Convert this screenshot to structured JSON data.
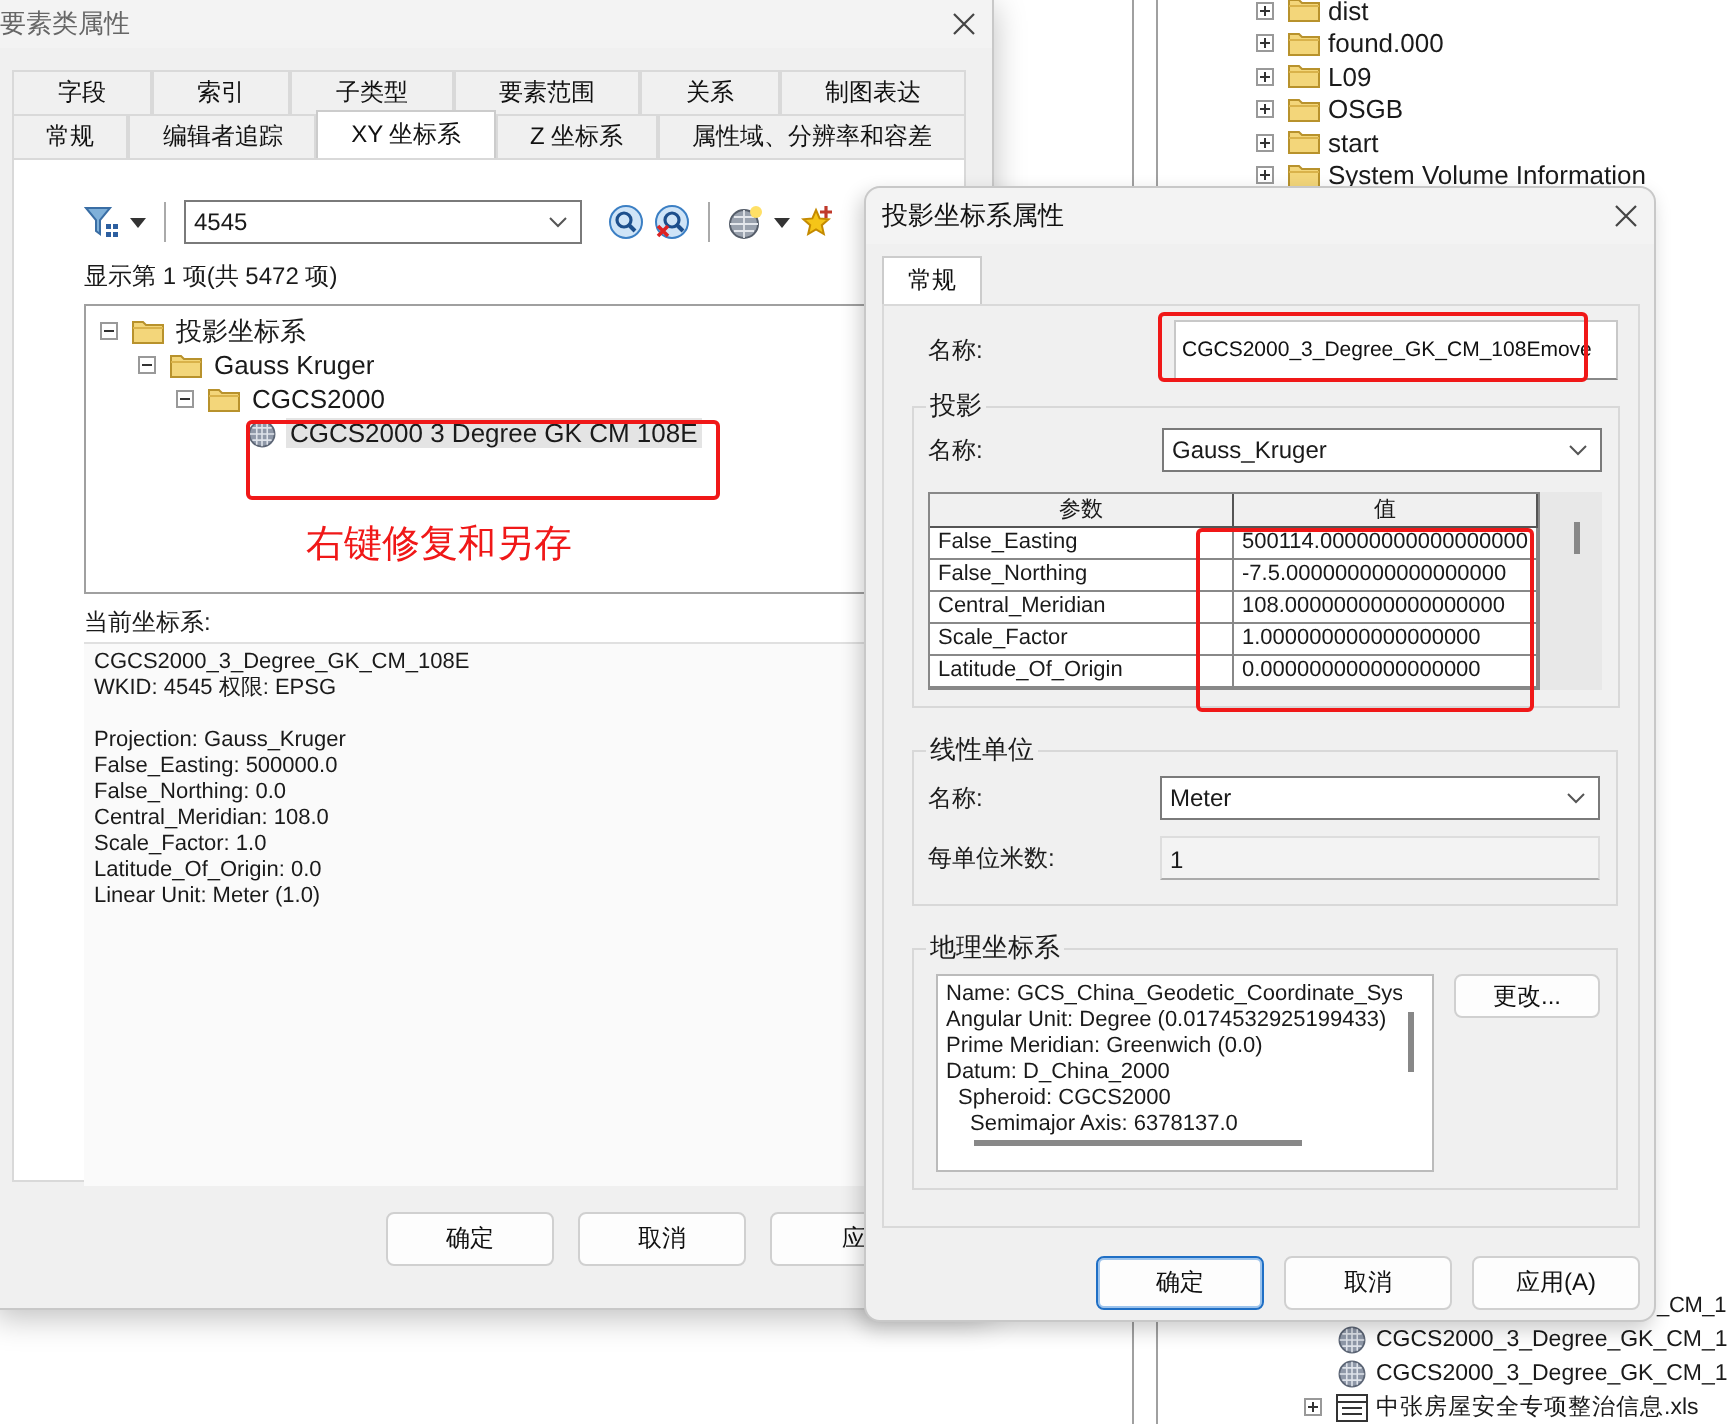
{
  "explorer": {
    "top_items": [
      {
        "label": "dist",
        "kind": "folder",
        "expandable": true
      },
      {
        "label": "found.000",
        "kind": "folder",
        "expandable": true
      },
      {
        "label": "L09",
        "kind": "folder",
        "expandable": true
      },
      {
        "label": "OSGB",
        "kind": "folder",
        "expandable": true
      },
      {
        "label": "start",
        "kind": "folder",
        "expandable": true
      },
      {
        "label": "System Volume Information",
        "kind": "folder",
        "expandable": true
      }
    ],
    "bottom_items": [
      {
        "label": "_CM_1",
        "partial": true
      },
      {
        "label": "CGCS2000_3_Degree_GK_CM_1",
        "kind": "globe",
        "expandable": false,
        "partial": false
      },
      {
        "label": "CGCS2000_3_Degree_GK_CM_1",
        "kind": "globe",
        "expandable": false,
        "partial": false
      },
      {
        "label": "中张房屋安全专项整治信息.xls",
        "kind": "table",
        "expandable": true,
        "partial": false
      }
    ]
  },
  "feature_class_dialog": {
    "title": "要素类属性",
    "tab_rows": [
      [
        {
          "label": "字段",
          "selected": false
        },
        {
          "label": "索引",
          "selected": false
        },
        {
          "label": "子类型",
          "selected": false
        },
        {
          "label": "要素范围",
          "selected": false
        },
        {
          "label": "关系",
          "selected": false
        },
        {
          "label": "制图表达",
          "selected": false
        }
      ],
      [
        {
          "label": "常规",
          "selected": false
        },
        {
          "label": "编辑者追踪",
          "selected": false
        },
        {
          "label": "XY 坐标系",
          "selected": true
        },
        {
          "label": "Z 坐标系",
          "selected": false
        },
        {
          "label": "属性域、分辨率和容差",
          "selected": false
        }
      ]
    ],
    "search_value": "4545",
    "match_count": "显示第 1 项(共 5472 项)",
    "tree": [
      {
        "label": "投影坐标系",
        "kind": "folder",
        "selected": false,
        "children": [
          {
            "label": "Gauss Kruger",
            "kind": "folder",
            "selected": false,
            "children": [
              {
                "label": "CGCS2000",
                "kind": "folder",
                "selected": false,
                "children": [
                  {
                    "label": "CGCS2000 3 Degree GK CM 108E",
                    "kind": "globe",
                    "selected": true
                  }
                ]
              }
            ]
          }
        ]
      }
    ],
    "annotation": "右键修复和另存",
    "current_label": "当前坐标系:",
    "current_blocks": [
      [
        "CGCS2000_3_Degree_GK_CM_108E",
        "WKID: 4545 权限: EPSG"
      ],
      [
        "Projection: Gauss_Kruger",
        "False_Easting: 500000.0",
        "False_Northing: 0.0",
        "Central_Meridian: 108.0",
        "Scale_Factor: 1.0",
        "Latitude_Of_Origin: 0.0",
        "Linear Unit: Meter (1.0)"
      ]
    ],
    "buttons": [
      "确定",
      "取消",
      "应"
    ]
  },
  "projection_dialog": {
    "title": "投影坐标系属性",
    "tabs": [
      {
        "label": "常规",
        "selected": true
      }
    ],
    "name_label": "名称:",
    "name_value": "CGCS2000_3_Degree_GK_CM_108Emove",
    "projection": {
      "legend": "投影",
      "name_label": "名称:",
      "name_value": "Gauss_Kruger",
      "columns": [
        "参数",
        "值"
      ],
      "rows": [
        [
          "False_Easting",
          "500114.00000000000000000"
        ],
        [
          "False_Northing",
          "-7.5.000000000000000000"
        ],
        [
          "Central_Meridian",
          "108.000000000000000000"
        ],
        [
          "Scale_Factor",
          "1.000000000000000000"
        ],
        [
          "Latitude_Of_Origin",
          "0.000000000000000000"
        ]
      ]
    },
    "linear_unit": {
      "legend": "线性单位",
      "name_label": "名称:",
      "name_value": "Meter",
      "meters_label": "每单位米数:",
      "meters_value": "1"
    },
    "geographic": {
      "legend": "地理坐标系",
      "change_button": "更改...",
      "lines": [
        {
          "text": "Name: GCS_China_Geodetic_Coordinate_Sys"
        },
        {
          "text": "Angular Unit: Degree (0.0174532925199433)"
        },
        {
          "text": "Prime Meridian: Greenwich (0.0)"
        },
        {
          "text": "Datum: D_China_2000",
          "children": [
            {
              "text": "Spheroid: CGCS2000",
              "children": [
                {
                  "text": "Semimajor Axis: 6378137.0"
                }
              ]
            }
          ]
        }
      ]
    },
    "buttons": [
      {
        "label": "确定",
        "default": true
      },
      {
        "label": "取消",
        "default": false
      },
      {
        "label": "应用(A)",
        "default": false
      }
    ]
  }
}
